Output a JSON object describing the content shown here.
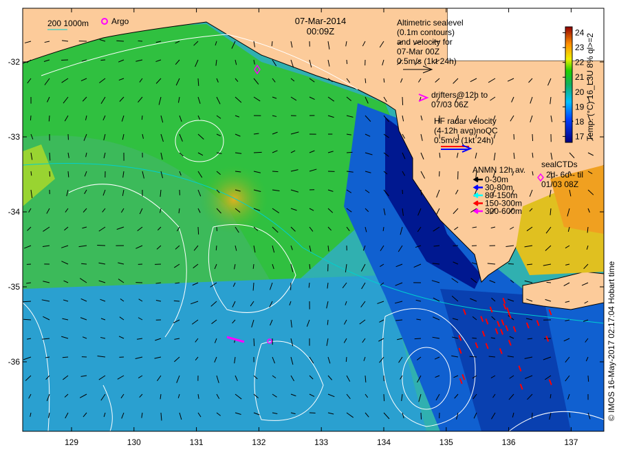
{
  "title": {
    "date": "07-Mar-2014",
    "time": "00:09Z"
  },
  "legend_top_left": {
    "isobaths": "200  1000m",
    "argo": "Argo"
  },
  "altimetry_note": [
    "Altimetric sealevel",
    "(0.1m contours)",
    "and velocity for",
    "07-Mar 00Z",
    "0.5m/s (1kt 24h)"
  ],
  "drifters_note": [
    "drifters@12h to",
    "07/03 06Z"
  ],
  "hf_radar_note": [
    "HF radar velocity",
    "(4-12h avg)noQC",
    "0.5m/s (1kt 24h)"
  ],
  "anmn_legend": {
    "title": "ANMN 12h av.",
    "items": [
      {
        "label": "0-30m",
        "color": "#000000"
      },
      {
        "label": "30-80m",
        "color": "#0000ff"
      },
      {
        "label": "80-150m",
        "color": "#00ffff"
      },
      {
        "label": "150-300m",
        "color": "#ff0000"
      },
      {
        "label": "300-600m",
        "color": "#ff00ff"
      }
    ]
  },
  "seal_ctds": {
    "title": "sealCTDs",
    "line1": "2d- 6d-- til",
    "line2": "01/03 08Z"
  },
  "colorbar": {
    "label": "Temp. (°C) 16_L3U 8% ql>=2",
    "ticks": [
      "24",
      "23",
      "22",
      "21",
      "20",
      "19",
      "18",
      "17"
    ],
    "range": [
      16.6,
      24.4
    ]
  },
  "credit": "© IMOS 16-May-2017 02:17:04 Hobart time",
  "axes": {
    "lon_ticks": [
      "129",
      "130",
      "131",
      "132",
      "133",
      "134",
      "135",
      "136",
      "137"
    ],
    "lat_ticks": [
      "-32",
      "-33",
      "-34",
      "-35",
      "-36"
    ]
  },
  "colors": {
    "land": "#fccb9a",
    "argo": "#ff00ff",
    "isobath": "#00d0d0"
  }
}
